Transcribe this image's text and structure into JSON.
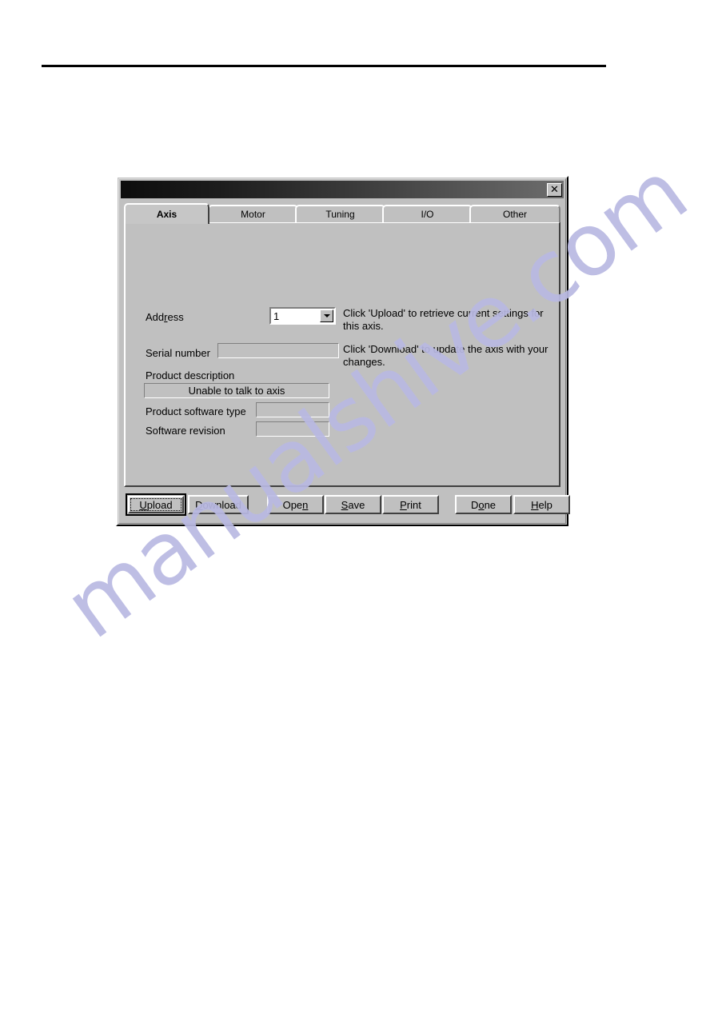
{
  "watermark": {
    "text": "manualshive.com",
    "color": "#b9b9e2"
  },
  "dialog": {
    "titlebar": {
      "title": "",
      "close_label": "✕"
    },
    "tabs": [
      {
        "label": "Axis",
        "active": true
      },
      {
        "label": "Motor",
        "active": false
      },
      {
        "label": "Tuning",
        "active": false
      },
      {
        "label": "I/O",
        "active": false
      },
      {
        "label": "Other",
        "active": false
      }
    ],
    "form": {
      "address": {
        "label_pre": "Add",
        "label_mn": "r",
        "label_post": "ess",
        "value": "1",
        "options": [
          "1"
        ]
      },
      "serial_number": {
        "label": "Serial number",
        "value": ""
      },
      "product_description": {
        "label": "Product description",
        "value": "Unable to talk to axis"
      },
      "product_software_type": {
        "label": "Product software type",
        "value": ""
      },
      "software_revision": {
        "label": "Software revision",
        "value": ""
      }
    },
    "info": {
      "line1": "Click 'Upload' to retrieve current settings for this axis.",
      "line2": "Click 'Download' to update the axis with your changes."
    },
    "buttons": [
      {
        "pre": "",
        "mn": "U",
        "post": "pload",
        "name": "upload-button",
        "default": true
      },
      {
        "pre": "",
        "mn": "D",
        "post": "ownload",
        "name": "download-button",
        "default": false
      },
      {
        "pre": "Ope",
        "mn": "n",
        "post": "",
        "name": "open-button",
        "default": false
      },
      {
        "pre": "",
        "mn": "S",
        "post": "ave",
        "name": "save-button",
        "default": false
      },
      {
        "pre": "",
        "mn": "P",
        "post": "rint",
        "name": "print-button",
        "default": false
      },
      {
        "pre": "D",
        "mn": "o",
        "post": "ne",
        "name": "done-button",
        "default": false
      },
      {
        "pre": "",
        "mn": "H",
        "post": "elp",
        "name": "help-button",
        "default": false
      }
    ]
  }
}
